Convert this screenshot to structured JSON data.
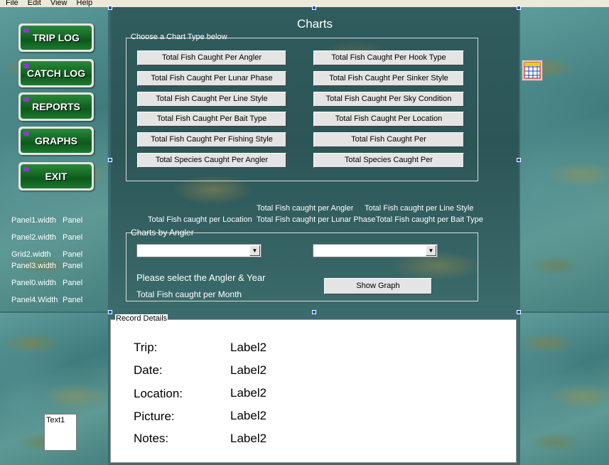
{
  "menu": [
    "File",
    "Edit",
    "View",
    "Help"
  ],
  "nav": {
    "trip_log": "TRIP LOG",
    "catch_log": "CATCH LOG",
    "reports": "REPORTS",
    "graphs": "GRAPHS",
    "exit": "EXIT"
  },
  "left_labels": [
    {
      "a": "Panel1.width",
      "b": "Panel"
    },
    {
      "a": "Panel2.width",
      "b": "Panel"
    },
    {
      "a": "Grid2.width",
      "b": "Panel"
    },
    {
      "a": "Panel3.width",
      "b": "Panel"
    },
    {
      "a": "Panel0.width",
      "b": "Panel"
    },
    {
      "a": "Panel4.Width",
      "b": "Panel"
    }
  ],
  "charts": {
    "title": "Charts",
    "group_title": "Choose a Chart Type below",
    "left_buttons": [
      "Total Fish Caught Per Angler",
      "Total Fish Caught Per Lunar Phase",
      "Total Fish Caught Per Line Style",
      "Total Fish Caught Per Bait Type",
      "Total Fish Caught Per Fishing Style",
      "Total Species Caught Per Angler"
    ],
    "right_buttons": [
      "Total Fish Caught Per Hook Type",
      "Total Fish Caught Per Sinker Style",
      "Total Fish Caught Per Sky Condition",
      "Total Fish Caught Per Location",
      "Total Fish Caught Per",
      "Total Species Caught Per"
    ],
    "captions": {
      "per_angler": "Total Fish caught per Angler",
      "per_line_style": "Total Fish caught per Line Style",
      "per_location": "Total Fish caught per Location",
      "per_lunar_phase": "Total Fish caught per Lunar Phase",
      "per_bait_type": "Total Fish caught per Bait Type"
    }
  },
  "by_angler": {
    "group_title": "Charts by Angler",
    "combo1_value": "",
    "combo2_value": "",
    "prompt": "Please select the Angler & Year",
    "subtitle": "Total Fish caught per Month",
    "show_graph": "Show Graph"
  },
  "record": {
    "group_title": "Record Details",
    "rows": [
      {
        "label": "Trip:",
        "value": "Label2"
      },
      {
        "label": "Date:",
        "value": "Label2"
      },
      {
        "label": "Location:",
        "value": "Label2"
      },
      {
        "label": "Picture:",
        "value": "Label2"
      },
      {
        "label": "Notes:",
        "value": "Label2"
      }
    ]
  },
  "textbox_value": "Text1"
}
